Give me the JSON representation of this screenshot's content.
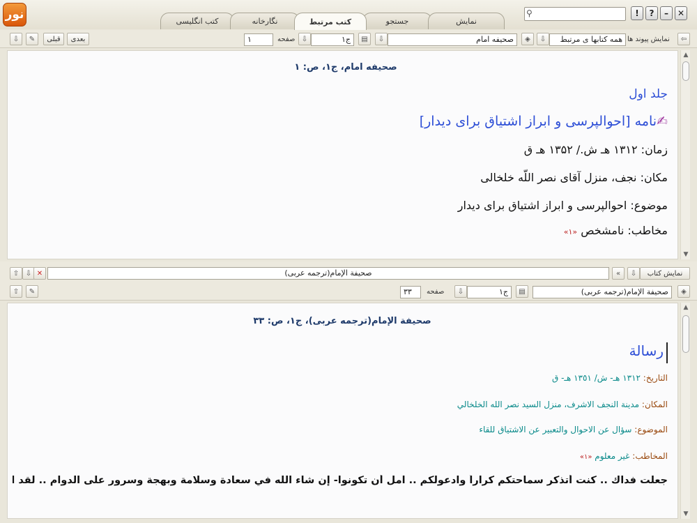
{
  "app": {
    "logo": "نور"
  },
  "tabs": [
    {
      "label": "نمایش"
    },
    {
      "label": "جستجو"
    },
    {
      "label": "کتب مرتبط"
    },
    {
      "label": "نگارخانه"
    },
    {
      "label": "کتب انگلیسی"
    }
  ],
  "search": {
    "value": ""
  },
  "window": {
    "help": "?",
    "info": "!",
    "min": "–",
    "close": "✕"
  },
  "top_toolbar": {
    "show_links_label": "نمایش پیوند ها",
    "books_select": "همه کتابها ی مرتبط",
    "book_select": "صحیفه امام",
    "volume_select": "ج۱",
    "page_label": "صفحه",
    "page_value": "۱",
    "prev_label": "قبلی",
    "next_label": "بعدی"
  },
  "top_doc": {
    "header": "صحیفه امام، ج۱، ص: ۱",
    "volume_title": "جلد اول",
    "letter_title": "نامه [احوالپرسی و ابراز اشتیاق برای دیدار]",
    "time": "زمان: ۱۳۱۲ هـ ش./ ۱۳۵۲ هـ ق",
    "place": "مکان: نجف، منزل آقای نصر اللّه خلخالی",
    "subject": "موضوع: احوالپرسی و ابراز اشتیاق برای دیدار",
    "addressee": "مخاطب: نامشخص",
    "footnote": "«۱»"
  },
  "mid_bar": {
    "show_book_label": "نمایش کتاب",
    "book_name": "صحيفة الإمام(ترجمه عربی)",
    "close_icon": "✕"
  },
  "bottom_toolbar": {
    "book_select": "صحيفة الإمام(ترجمه عربی)",
    "volume_select": "ج۱",
    "page_label": "صفحه",
    "page_value": "۳۳"
  },
  "bottom_doc": {
    "header": "صحيفة الإمام(ترجمه عربی)، ج۱، ص: ۳۳",
    "title": "رسالة",
    "date_label": "التاريخ:",
    "date_value": "١٣١٢ هـ- ش/ ١٣٥١ هـ- ق",
    "place_label": "المكان:",
    "place_value": "مدينة النجف الاشرف، منزل السيد نصر الله الخلخالي",
    "subject_label": "الموضوع:",
    "subject_value": "سؤال عن الاحوال والتعبير عن الاشتياق للقاء",
    "addressee_label": "المخاطب:",
    "addressee_value": "غير معلوم",
    "footnote": "«۱»",
    "body": "جعلت فداك .. كنت أتذكر سماحتكم كراراً وادعولكم .. آمل أن تكونوا- إن شاء الله في سعادة وسلامة وبهجة وسرور على الدوام .. لقد اشتقت"
  },
  "colors": {
    "blue": "#2d4ed6",
    "cyan": "#0a8a8a",
    "brown": "#9a4a10",
    "header": "#1e3a6a",
    "logo": "#e0701e"
  }
}
